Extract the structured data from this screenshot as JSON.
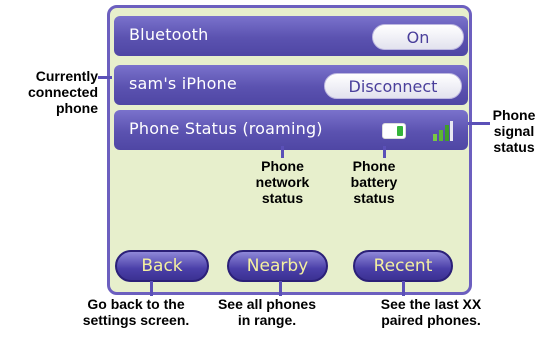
{
  "screen": {
    "bluetooth_row": {
      "label": "Bluetooth",
      "toggle_label": "On"
    },
    "device_row": {
      "label": "sam's iPhone",
      "action_label": "Disconnect"
    },
    "status_row": {
      "label": "Phone Status (roaming)"
    },
    "buttons": {
      "back": "Back",
      "nearby": "Nearby",
      "recent": "Recent"
    }
  },
  "callouts": {
    "currently_connected": [
      "Currently",
      "connected",
      "phone"
    ],
    "phone_signal": [
      "Phone",
      "signal",
      "status"
    ],
    "network": [
      "Phone",
      "network",
      "status"
    ],
    "battery": [
      "Phone",
      "battery",
      "status"
    ],
    "back": [
      "Go back to the",
      "settings screen."
    ],
    "nearby": [
      "See all phones",
      "in range."
    ],
    "recent": [
      "See the last XX",
      "paired phones."
    ]
  },
  "colors": {
    "row_bg": "#5b52b0",
    "screen_bg": "#e7efcc",
    "button_text": "#f4f0a0",
    "battery_green": "#34b43a"
  },
  "icons": {
    "battery": "battery-icon",
    "signal": "signal-strength-icon"
  }
}
